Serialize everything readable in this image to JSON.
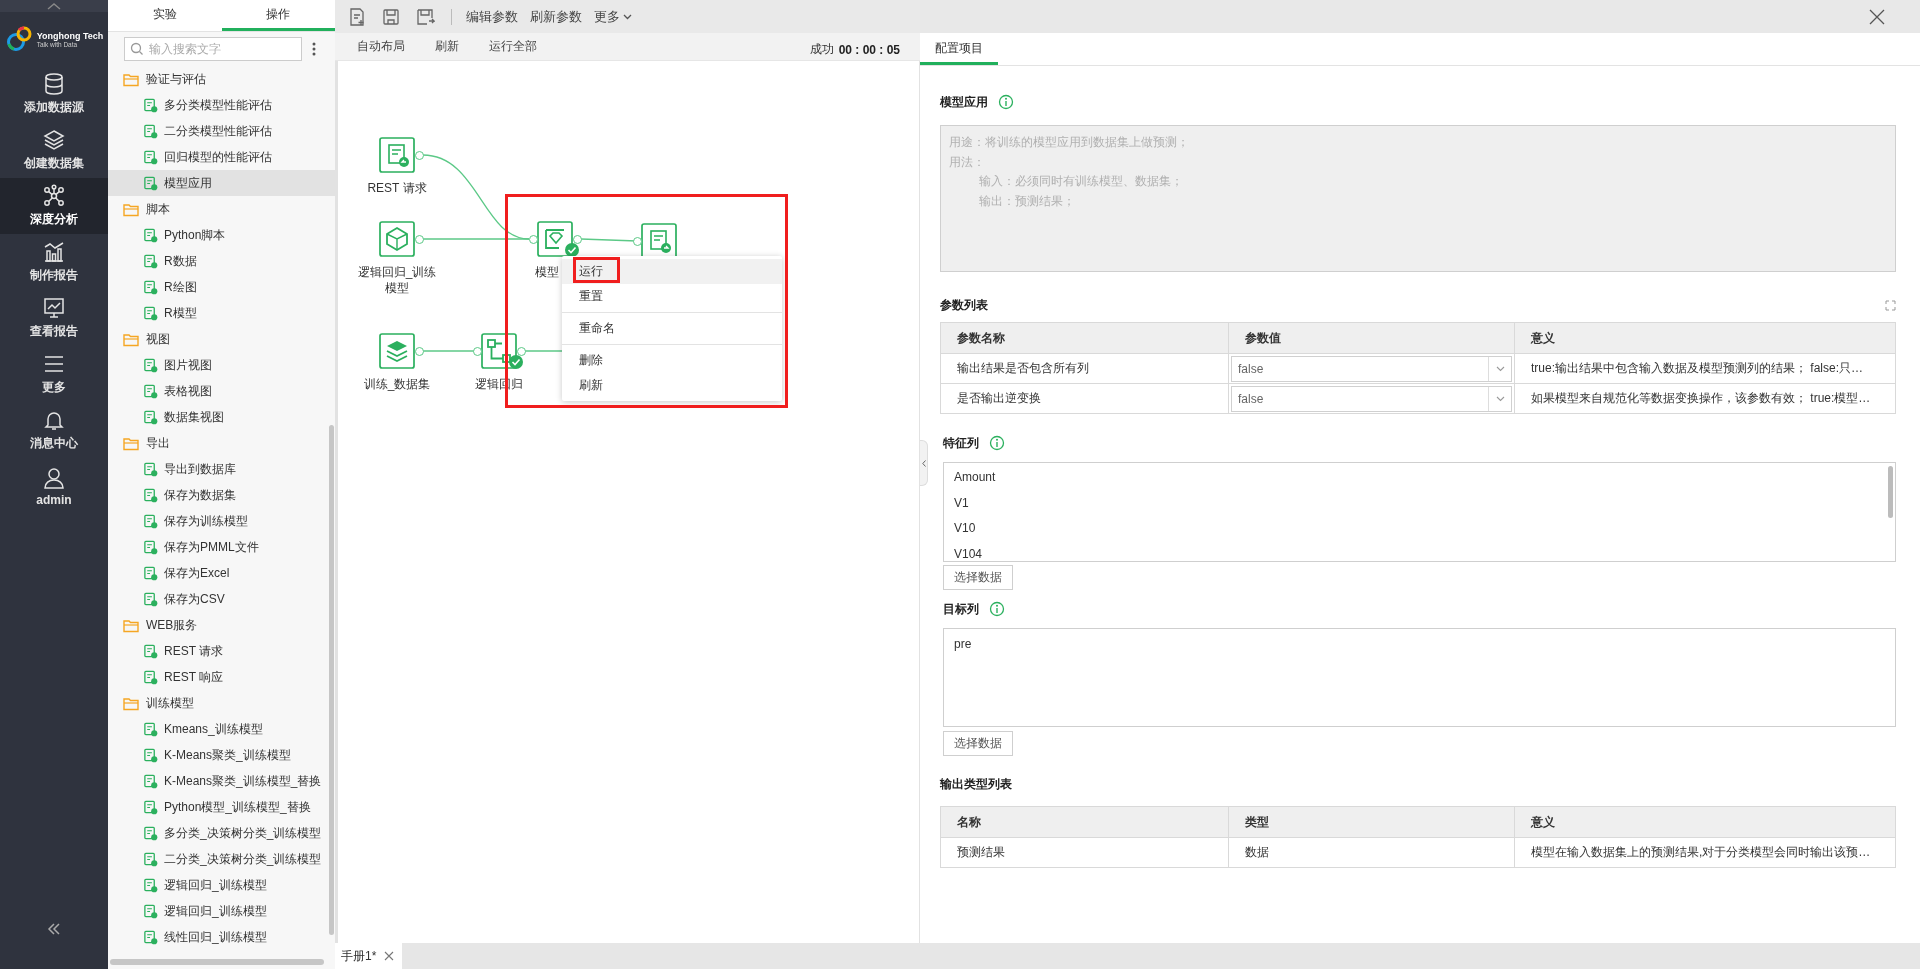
{
  "nav": {
    "logo": {
      "name": "Yonghong Tech",
      "tagline": "Talk with Data"
    },
    "items": [
      {
        "label": "添加数据源",
        "selected": false
      },
      {
        "label": "创建数据集",
        "selected": false
      },
      {
        "label": "深度分析",
        "selected": true
      },
      {
        "label": "制作报告",
        "selected": false
      },
      {
        "label": "查看报告",
        "selected": false
      },
      {
        "label": "更多",
        "selected": false
      },
      {
        "label": "消息中心",
        "selected": false
      },
      {
        "label": "admin",
        "selected": false
      }
    ]
  },
  "sidebar": {
    "tabs": [
      {
        "label": "实验",
        "selected": false
      },
      {
        "label": "操作",
        "selected": true
      }
    ],
    "search": {
      "placeholder": "输入搜索文字"
    },
    "tree": [
      {
        "label": "验证与评估",
        "expanded": true,
        "children": [
          {
            "label": "多分类模型性能评估",
            "selected": false
          },
          {
            "label": "二分类模型性能评估",
            "selected": false
          },
          {
            "label": "回归模型的性能评估",
            "selected": false
          },
          {
            "label": "模型应用",
            "selected": true
          }
        ]
      },
      {
        "label": "脚本",
        "expanded": true,
        "children": [
          {
            "label": "Python脚本",
            "selected": false
          },
          {
            "label": "R数据",
            "selected": false
          },
          {
            "label": "R绘图",
            "selected": false
          },
          {
            "label": "R模型",
            "selected": false
          }
        ]
      },
      {
        "label": "视图",
        "expanded": true,
        "children": [
          {
            "label": "图片视图",
            "selected": false
          },
          {
            "label": "表格视图",
            "selected": false
          },
          {
            "label": "数据集视图",
            "selected": false
          }
        ]
      },
      {
        "label": "导出",
        "expanded": true,
        "children": [
          {
            "label": "导出到数据库",
            "selected": false
          },
          {
            "label": "保存为数据集",
            "selected": false
          },
          {
            "label": "保存为训练模型",
            "selected": false
          },
          {
            "label": "保存为PMML文件",
            "selected": false
          },
          {
            "label": "保存为Excel",
            "selected": false
          },
          {
            "label": "保存为CSV",
            "selected": false
          }
        ]
      },
      {
        "label": "WEB服务",
        "expanded": true,
        "children": [
          {
            "label": "REST 请求",
            "selected": false
          },
          {
            "label": "REST 响应",
            "selected": false
          }
        ]
      },
      {
        "label": "训练模型",
        "expanded": true,
        "children": [
          {
            "label": "Kmeans_训练模型",
            "selected": false
          },
          {
            "label": "K-Means聚类_训练模型",
            "selected": false
          },
          {
            "label": "K-Means聚类_训练模型_替换",
            "selected": false
          },
          {
            "label": "Python模型_训练模型_替换",
            "selected": false
          },
          {
            "label": "多分类_决策树分类_训练模型",
            "selected": false
          },
          {
            "label": "二分类_决策树分类_训练模型",
            "selected": false
          },
          {
            "label": "逻辑回归_训练模型",
            "selected": false
          },
          {
            "label": "逻辑回归_训练模型",
            "selected": false
          },
          {
            "label": "线性回归_训练模型",
            "selected": false
          }
        ]
      }
    ]
  },
  "toolbar": {
    "buttons": [
      "编辑参数",
      "刷新参数"
    ],
    "more": "更多"
  },
  "canvas_toolbar": {
    "buttons": [
      "自动布局",
      "刷新",
      "运行全部"
    ],
    "status": "成功",
    "elapsed": "00 : 00 : 05"
  },
  "canvas": {
    "nodes": [
      {
        "label": "REST 请求",
        "done": false
      },
      {
        "label": "逻辑回归_训练模型",
        "done": false
      },
      {
        "label": "训练_数据集",
        "done": false
      },
      {
        "label": "逻辑回归",
        "done": true
      },
      {
        "label": "模型",
        "done": true
      },
      {
        "done": false
      }
    ],
    "context_menu": {
      "groups": [
        {
          "items": [
            {
              "label": "运行",
              "selected": true
            },
            {
              "label": "重置",
              "selected": false
            }
          ]
        },
        {
          "items": [
            {
              "label": "重命名",
              "selected": false
            }
          ]
        },
        {
          "items": [
            {
              "label": "删除",
              "selected": false
            },
            {
              "label": "刷新",
              "selected": false
            }
          ]
        }
      ]
    }
  },
  "doc_tabs": [
    {
      "label": "手册1*",
      "selected": true
    }
  ],
  "panel": {
    "tabs": [
      {
        "label": "配置项目",
        "selected": true
      }
    ],
    "title": "模型应用",
    "description": [
      {
        "text": "用途：将训练的模型应用到数据集上做预测；"
      },
      {
        "text": "用法：",
        "children": [
          {
            "text": "输入：必须同时有训练模型、数据集；"
          },
          {
            "text": "输出：预测结果；"
          }
        ]
      }
    ],
    "params": {
      "title": "参数列表",
      "columns": [
        "参数名称",
        "参数值",
        "意义"
      ],
      "rows": [
        {
          "name": "输出结果是否包含所有列",
          "value": "false",
          "meaning": "true:输出结果中包含输入数据及模型预测列的结果； false:只…"
        },
        {
          "name": "是否输出逆变换",
          "value": "false",
          "meaning": "如果模型来自规范化等数据变换操作，该参数有效； true:模型…"
        }
      ]
    },
    "features": {
      "title": "特征列",
      "items": [
        "Amount",
        "V1",
        "V10",
        "V104"
      ],
      "button": "选择数据"
    },
    "target": {
      "title": "目标列",
      "value": "pre",
      "button": "选择数据"
    },
    "outputs": {
      "title": "输出类型列表",
      "columns": [
        "名称",
        "类型",
        "意义"
      ],
      "rows": [
        {
          "name": "预测结果",
          "type": "数据",
          "meaning": "模型在输入数据集上的预测结果,对于分类模型会同时输出该预…"
        }
      ]
    }
  }
}
